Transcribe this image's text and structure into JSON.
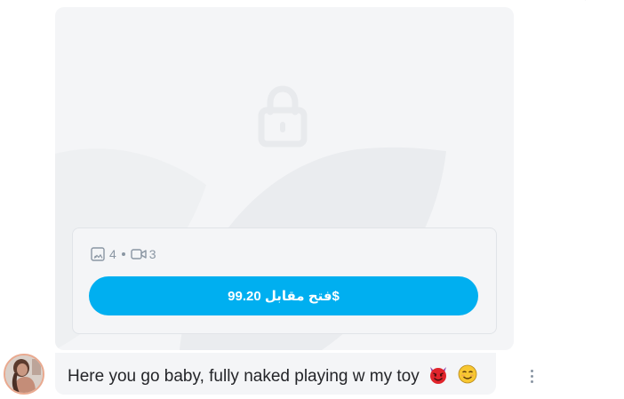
{
  "post": {
    "media": {
      "photos_count": "4",
      "videos_count": "3",
      "photo_icon": "image-icon",
      "video_icon": "video-camera-icon",
      "lock_icon": "lock-icon"
    },
    "unlock_button_label": "فتح مقابل 99.20$"
  },
  "message": {
    "text": "Here you go baby, fully naked playing w my toy",
    "emojis": [
      "smiling-imp-emoji",
      "smiling-face-emoji"
    ]
  },
  "colors": {
    "accent": "#00aff0",
    "card_background": "#f4f5f7",
    "muted_text": "#8a96a3",
    "body_text": "#242529"
  }
}
